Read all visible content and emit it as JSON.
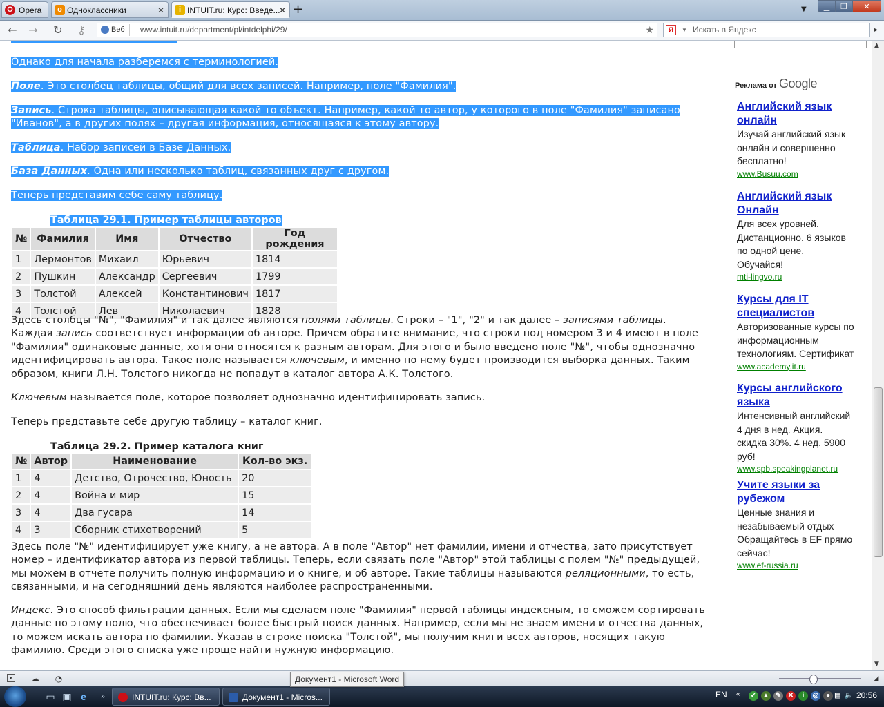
{
  "browser": {
    "menu_label": "Opera",
    "tabs": [
      {
        "label": "Одноклассники",
        "active": false
      },
      {
        "label": "INTUIT.ru: Курс: Введе...",
        "active": true
      }
    ],
    "web_label": "Веб",
    "url": "www.intuit.ru/department/pl/intdelphi/29/",
    "search_placeholder": "Искать в Яндекс",
    "yandex_logo": "Я"
  },
  "article": {
    "p1": "Однако для начала разберемся с терминологией.",
    "def_field_term": "Поле",
    "def_field_text": ". Это столбец таблицы, общий для всех записей. Например, поле \"Фамилия\".",
    "def_record_term": "Запись",
    "def_record_text": ". Строка таблицы, описывающая какой то объект. Например, какой то автор, у которого в поле \"Фамилия\" записано",
    "def_record_text2": "\"Иванов\", а в других полях – другая информация, относящаяся к этому автору.",
    "def_table_term": "Таблица",
    "def_table_text": ". Набор записей в Базе Данных.",
    "def_db_term": "База Данных",
    "def_db_text": ". Одна или несколько таблиц, связанных друг с другом.",
    "p_now": "Теперь представим себе саму таблицу.",
    "table1_caption": "Таблица 29.1. Пример таблицы авторов",
    "table1": {
      "headers": [
        "№",
        "Фамилия",
        "Имя",
        "Отчество",
        "Год рождения"
      ],
      "rows": [
        [
          "1",
          "Лермонтов",
          "Михаил",
          "Юрьевич",
          "1814"
        ],
        [
          "2",
          "Пушкин",
          "Александр",
          "Сергеевич",
          "1799"
        ],
        [
          "3",
          "Толстой",
          "Алексей",
          "Константинович",
          "1817"
        ],
        [
          "4",
          "Толстой",
          "Лев",
          "Николаевич",
          "1828"
        ]
      ]
    },
    "p_after1_a": "Здесь столбцы \"№\", \"Фамилия\" и так далее являются ",
    "p_after1_i1": "полями таблицы",
    "p_after1_b": ". Строки – \"1\", \"2\" и так далее – ",
    "p_after1_i2": "записями таблицы",
    "p_after1_c": ".",
    "p_after1_d": "Каждая ",
    "p_after1_i3": "запись",
    "p_after1_e": " соответствует информации об авторе. Причем обратите внимание, что строки под номером 3 и 4 имеют в поле",
    "p_after1_f": "\"Фамилия\" одинаковые данные, хотя они относятся к разным авторам. Для этого и было введено поле \"№\", чтобы однозначно",
    "p_after1_g": "идентифицировать автора. Такое поле называется ",
    "p_after1_i4": "ключевым",
    "p_after1_h": ", и именно по нему будет производится выборка данных. Таким",
    "p_after1_j": "образом, книги Л.Н. Толстого никогда не попадут в каталог автора А.К. Толстого.",
    "p_key_i": "Ключевым",
    "p_key_text": " называется поле, которое позволяет однозначно идентифицировать запись.",
    "p_now2": "Теперь представьте себе другую таблицу – каталог книг.",
    "table2_caption": "Таблица 29.2. Пример каталога книг",
    "table2": {
      "headers": [
        "№",
        "Автор",
        "Наименование",
        "Кол-во экз."
      ],
      "rows": [
        [
          "1",
          "4",
          "Детство, Отрочество, Юность",
          "20"
        ],
        [
          "2",
          "4",
          "Война и мир",
          "15"
        ],
        [
          "3",
          "4",
          "Два гусара",
          "14"
        ],
        [
          "4",
          "3",
          "Сборник стихотворений",
          "5"
        ]
      ]
    },
    "p_after2_a": "Здесь поле \"№\" идентифицирует уже книгу, а не автора. А в поле \"Автор\" нет фамилии, имени и отчества, зато присутствует",
    "p_after2_b": "номер – идентификатор автора из первой таблицы. Теперь, если связать поле \"Автор\" этой таблицы с полем \"№\" предыдущей,",
    "p_after2_c": "мы можем в отчете получить полную информацию и о книге, и об авторе. Такие таблицы называются ",
    "p_after2_i": "реляционными",
    "p_after2_d": ", то есть,",
    "p_after2_e": "связанными, и на сегодняшний день являются наиболее распространенными.",
    "p_index_i": "Индекс",
    "p_index_a": ". Это способ фильтрации данных. Если мы сделаем поле \"Фамилия\" первой таблицы индексным, то сможем сортировать",
    "p_index_b": "данные по этому полю, что обеспечивает более быстрый поиск данных. Например, если мы не знаем имени и отчества данных,",
    "p_index_c": "то можем искать автора по фамилии. Указав в строке поиска \"Толстой\", мы получим книги всех авторов, носящих такую",
    "p_index_d": "фамилию. Среди этого списка уже проще найти нужную информацию."
  },
  "sidebar": {
    "ads_by": "Реклама от",
    "google": "Google",
    "ads": [
      {
        "title1": "Английский язык",
        "title2": "онлайн",
        "text": [
          "Изучай английский язык",
          "онлайн и совершенно",
          "бесплатно!"
        ],
        "url": "www.Busuu.com"
      },
      {
        "title1": "Английский язык",
        "title2": "Онлайн",
        "text": [
          "Для всех уровней.",
          "Дистанционно. 6 языков",
          "по одной цене.",
          "Обучайся!"
        ],
        "url": "mti-lingvo.ru"
      },
      {
        "title1": "Курсы для IT",
        "title2": "специалистов",
        "text": [
          "Авторизованные курсы по",
          "информационным",
          "технологиям. Сертификат"
        ],
        "url": "www.academy.it.ru"
      },
      {
        "title1": "Курсы английского",
        "title2": "языка",
        "text": [
          "Интенсивный английский",
          "4 дня в нед. Акция.",
          "скидка 30%. 4 нед. 5900",
          "руб!"
        ],
        "url": "www.spb.speakingplanet.ru"
      },
      {
        "title1": "Учите языки за",
        "title2": "рубежом",
        "text": [
          "Ценные знания и",
          "незабываемый отдых",
          "Обращайтесь в EF прямо",
          "сейчас!"
        ],
        "url": "www.ef-russia.ru"
      }
    ]
  },
  "status": {
    "tooltip": "Документ1 - Microsoft Word"
  },
  "taskbar": {
    "btn_opera": "INTUIT.ru: Курс: Вв...",
    "btn_word": "Документ1 - Micros...",
    "lang": "EN",
    "clock": "20:56"
  }
}
